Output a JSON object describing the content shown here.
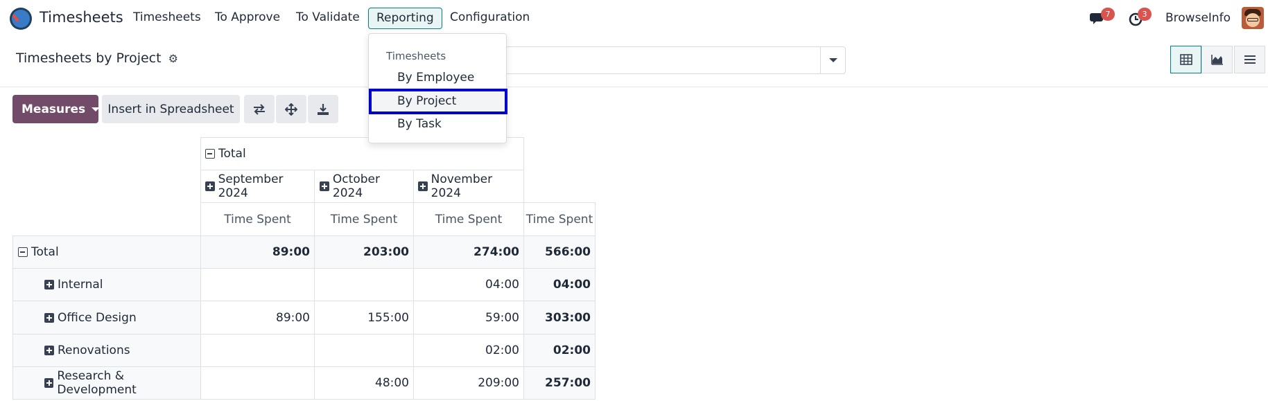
{
  "navbar": {
    "app_name": "Timesheets",
    "menu": [
      "Timesheets",
      "To Approve",
      "To Validate",
      "Reporting",
      "Configuration"
    ],
    "messages_badge": "7",
    "activities_badge": "3",
    "user_name": "BrowseInfo"
  },
  "control_panel": {
    "title": "Timesheets by Project",
    "search_placeholder": ""
  },
  "toolbar": {
    "measures_label": "Measures",
    "insert_label": "Insert in Spreadsheet"
  },
  "dropdown": {
    "header": "Timesheets",
    "items": [
      "By Employee",
      "By Project",
      "By Task"
    ],
    "selected": "By Project"
  },
  "pivot": {
    "col_total_label": "Total",
    "months": [
      "September 2024",
      "October 2024",
      "November 2024"
    ],
    "measure": "Time Spent",
    "row_total_label": "Total",
    "total_row": [
      "89:00",
      "203:00",
      "274:00",
      "566:00"
    ],
    "rows": [
      {
        "label": "Internal",
        "values": [
          "",
          "",
          "04:00",
          "04:00"
        ]
      },
      {
        "label": "Office Design",
        "values": [
          "89:00",
          "155:00",
          "59:00",
          "303:00"
        ]
      },
      {
        "label": "Renovations",
        "values": [
          "",
          "",
          "02:00",
          "02:00"
        ]
      },
      {
        "label": "Research & Development",
        "values": [
          "",
          "48:00",
          "209:00",
          "257:00"
        ]
      }
    ]
  },
  "colors": {
    "primary": "#714b67",
    "accent": "#017e84",
    "badge": "#d9534f",
    "highlight_border": "#0000cc"
  }
}
